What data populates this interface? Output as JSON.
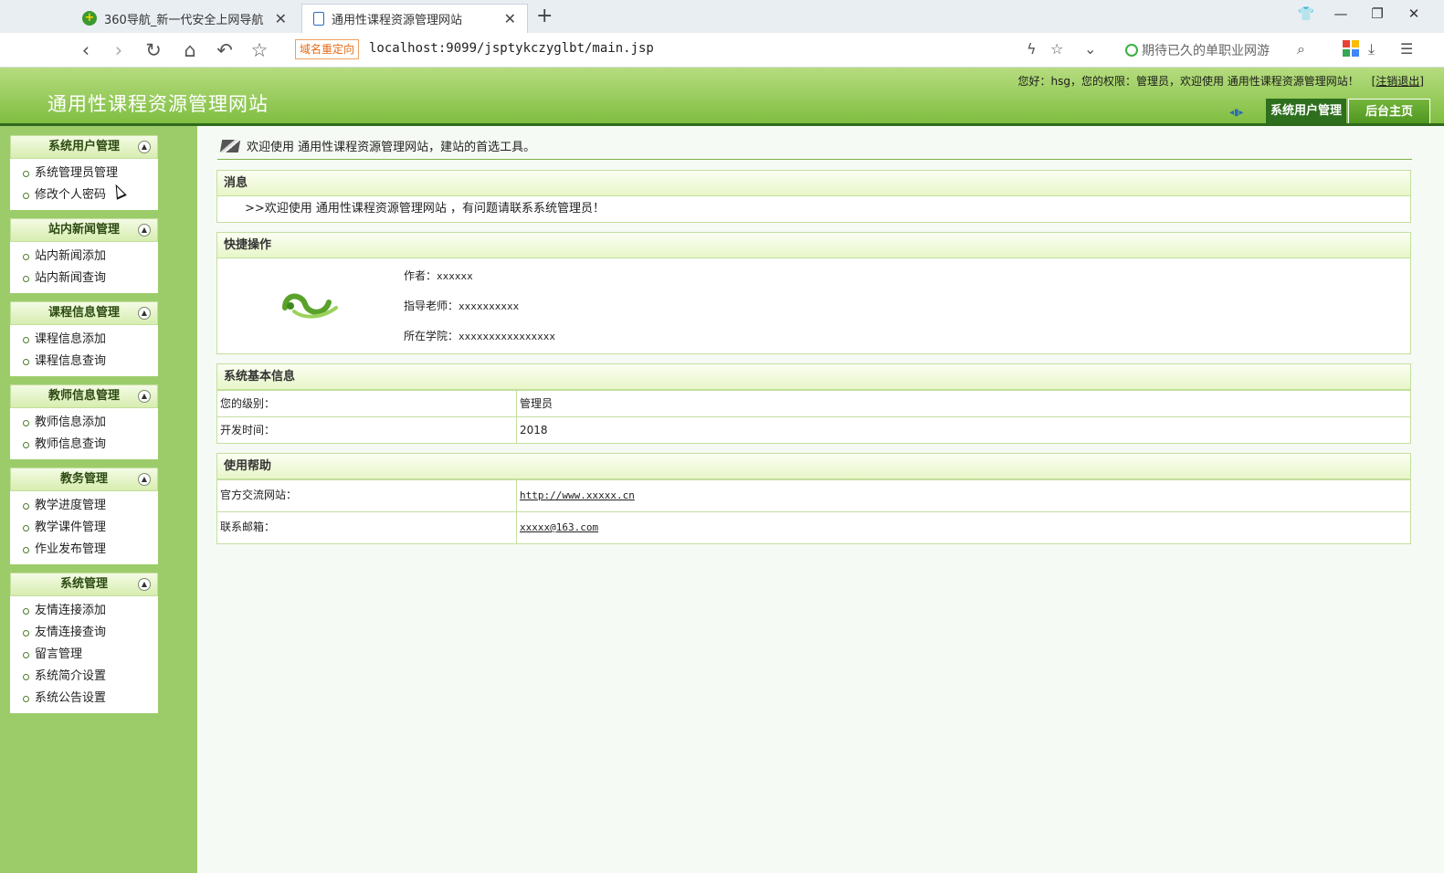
{
  "browser": {
    "tabs": [
      {
        "title": "360导航_新一代安全上网导航",
        "active": false
      },
      {
        "title": "通用性课程资源管理网站",
        "active": true
      }
    ],
    "redirect_badge": "域名重定向",
    "url": "localhost:9099/jsptykczyglbt/main.jsp",
    "search_suggestion": "期待已久的单职业网游",
    "colors": {
      "accent": "#3cb043",
      "badge": "#e46a16"
    }
  },
  "site": {
    "title": "通用性课程资源管理网站",
    "greeting": "您好：hsg，您的权限：管理员，欢迎使用 通用性课程资源管理网站！",
    "logout": "[注销退出]",
    "active_module": "系统用户管理",
    "home_button": "后台主页",
    "colors": {
      "header_top": "#b6dc7f",
      "header_bottom": "#7ebd3f",
      "sidebar": "#9ccc6a",
      "dark_green": "#2e6f1e"
    }
  },
  "sidebar": {
    "groups": [
      {
        "title": "系统用户管理",
        "items": [
          "系统管理员管理",
          "修改个人密码"
        ]
      },
      {
        "title": "站内新闻管理",
        "items": [
          "站内新闻添加",
          "站内新闻查询"
        ]
      },
      {
        "title": "课程信息管理",
        "items": [
          "课程信息添加",
          "课程信息查询"
        ]
      },
      {
        "title": "教师信息管理",
        "items": [
          "教师信息添加",
          "教师信息查询"
        ]
      },
      {
        "title": "教务管理",
        "items": [
          "教学进度管理",
          "教学课件管理",
          "作业发布管理"
        ]
      },
      {
        "title": "系统管理",
        "items": [
          "友情连接添加",
          "友情连接查询",
          "留言管理",
          "系统简介设置",
          "系统公告设置"
        ]
      }
    ]
  },
  "main": {
    "welcome": "欢迎使用 通用性课程资源管理网站，建站的首选工具。",
    "message": {
      "title": "消息",
      "text": ">>欢迎使用 通用性课程资源管理网站 ，有问题请联系系统管理员！"
    },
    "quick": {
      "title": "快捷操作",
      "author_label": "作者：",
      "author": "xxxxxx",
      "advisor_label": "指导老师：",
      "advisor": "xxxxxxxxxx",
      "college_label": "所在学院：",
      "college": "xxxxxxxxxxxxxxxx"
    },
    "sysinfo": {
      "title": "系统基本信息",
      "rows": [
        {
          "label": "您的级别：",
          "value": "管理员"
        },
        {
          "label": "开发时间：",
          "value": "2018"
        }
      ]
    },
    "help": {
      "title": "使用帮助",
      "rows": [
        {
          "label": "官方交流网站：",
          "value": "http://www.xxxxx.cn"
        },
        {
          "label": "联系邮箱：",
          "value": "xxxxx@163.com"
        }
      ]
    }
  }
}
